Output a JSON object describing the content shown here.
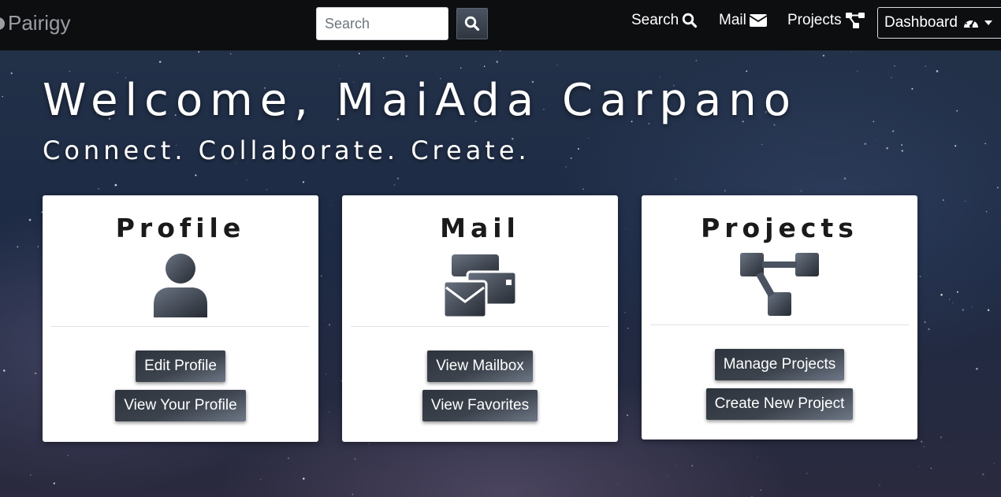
{
  "brand": {
    "name": "Pairigy"
  },
  "search": {
    "placeholder": "Search",
    "button_icon": "search-icon"
  },
  "nav": {
    "search_label": "Search",
    "mail_label": "Mail",
    "projects_label": "Projects",
    "dashboard_label": "Dashboard"
  },
  "hero": {
    "title": "Welcome, MaiAda Carpano",
    "subtitle": "Connect. Collaborate. Create."
  },
  "cards": {
    "profile": {
      "title": "Profile",
      "icon": "user-icon",
      "buttons": [
        "Edit Profile",
        "View Your Profile"
      ]
    },
    "mail": {
      "title": "Mail",
      "icon": "mail-stack-icon",
      "buttons": [
        "View Mailbox",
        "View Favorites"
      ]
    },
    "projects": {
      "title": "Projects",
      "icon": "project-tree-icon",
      "buttons": [
        "Manage Projects",
        "Create New Project"
      ]
    }
  },
  "colors": {
    "navbar": "#0d0e10",
    "button_dark": "#2e343d",
    "card_bg": "#ffffff"
  }
}
